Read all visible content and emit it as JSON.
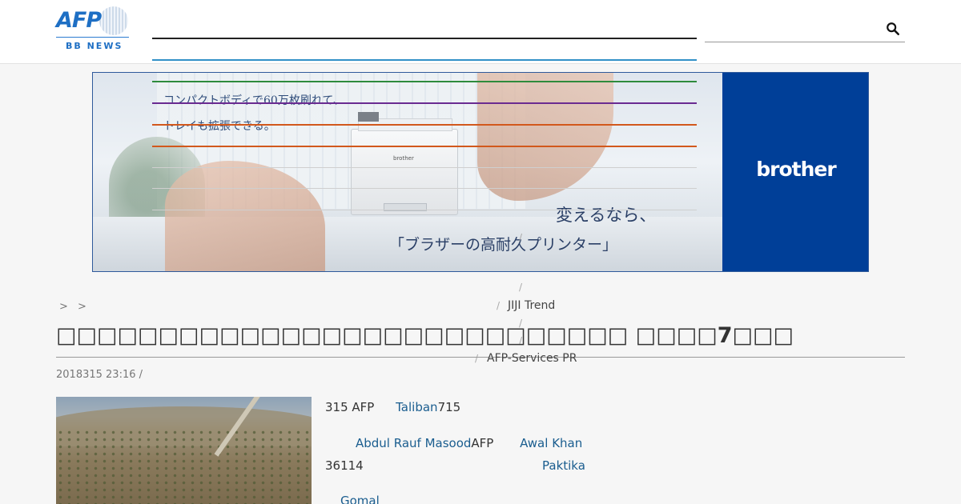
{
  "header": {
    "logo_text": "AFP",
    "logo_subtitle": "BB NEWS",
    "search_placeholder": ""
  },
  "ad": {
    "copy_line1": "コンパクトボディで60万枚刷れて、",
    "copy_line2": "トレイも拡張できる。",
    "tagline1": "変えるなら、",
    "tagline2": "「ブラザーの高耐久プリンター」",
    "brand": "brother",
    "printer_label": "brother"
  },
  "services": {
    "jiji": "JIJI Trend",
    "afp_pr": "AFP-Services PR"
  },
  "breadcrumb": [
    ">",
    ">"
  ],
  "article": {
    "title": "□□□□□□□□□□□□□□□□□□□□□□□□□□□□ □□□□7□□□",
    "meta": "2018315 23:16  /",
    "lines": {
      "l1_a": "315 AFP",
      "l1_link": "Taliban",
      "l1_b": "715",
      "l2_link1": "Abdul Rauf Masood",
      "l2_a": "AFP",
      "l2_link2": "Awal Khan",
      "l3_a": "36114",
      "l3_link": "Paktika",
      "l4_link": "Gomal"
    }
  },
  "colors": {
    "accent_blue": "#3291c7",
    "brand_blue": "#003f98",
    "link": "#1a5d8f"
  }
}
